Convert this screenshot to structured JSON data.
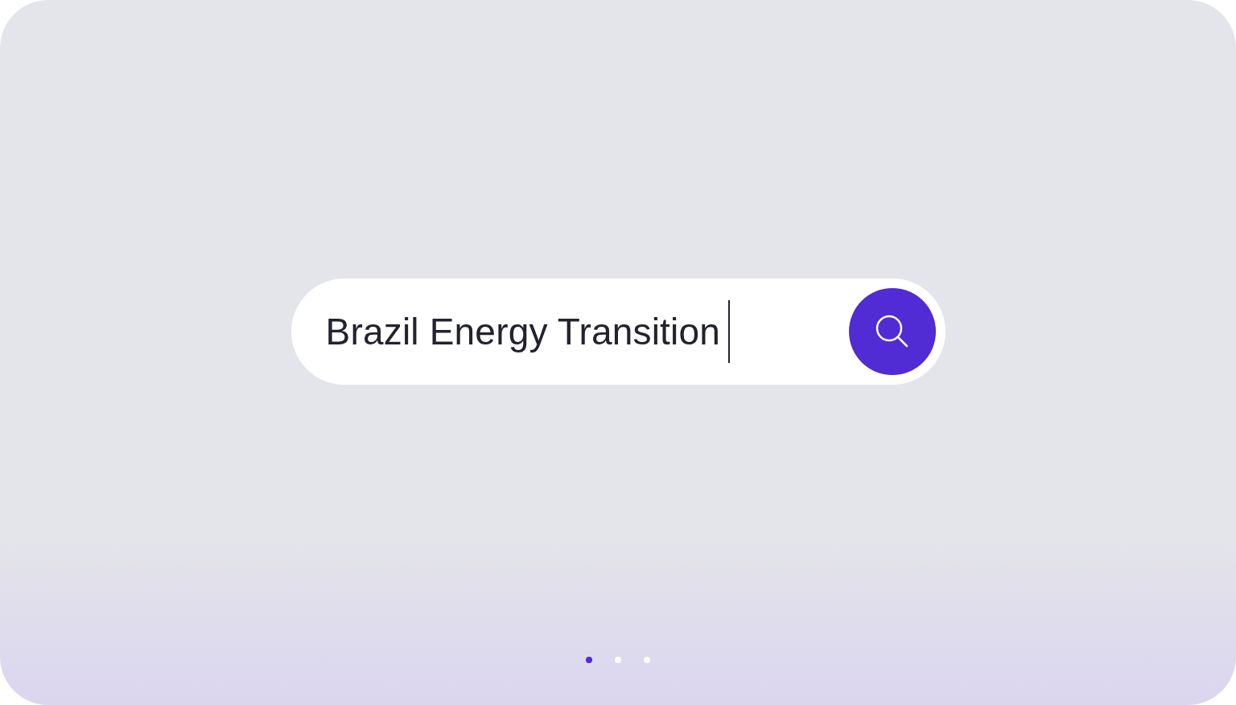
{
  "search": {
    "value": "Brazil Energy Transition",
    "focused": true
  },
  "pagination": [
    {
      "selected": true
    },
    {
      "selected": false
    },
    {
      "selected": false
    }
  ]
}
